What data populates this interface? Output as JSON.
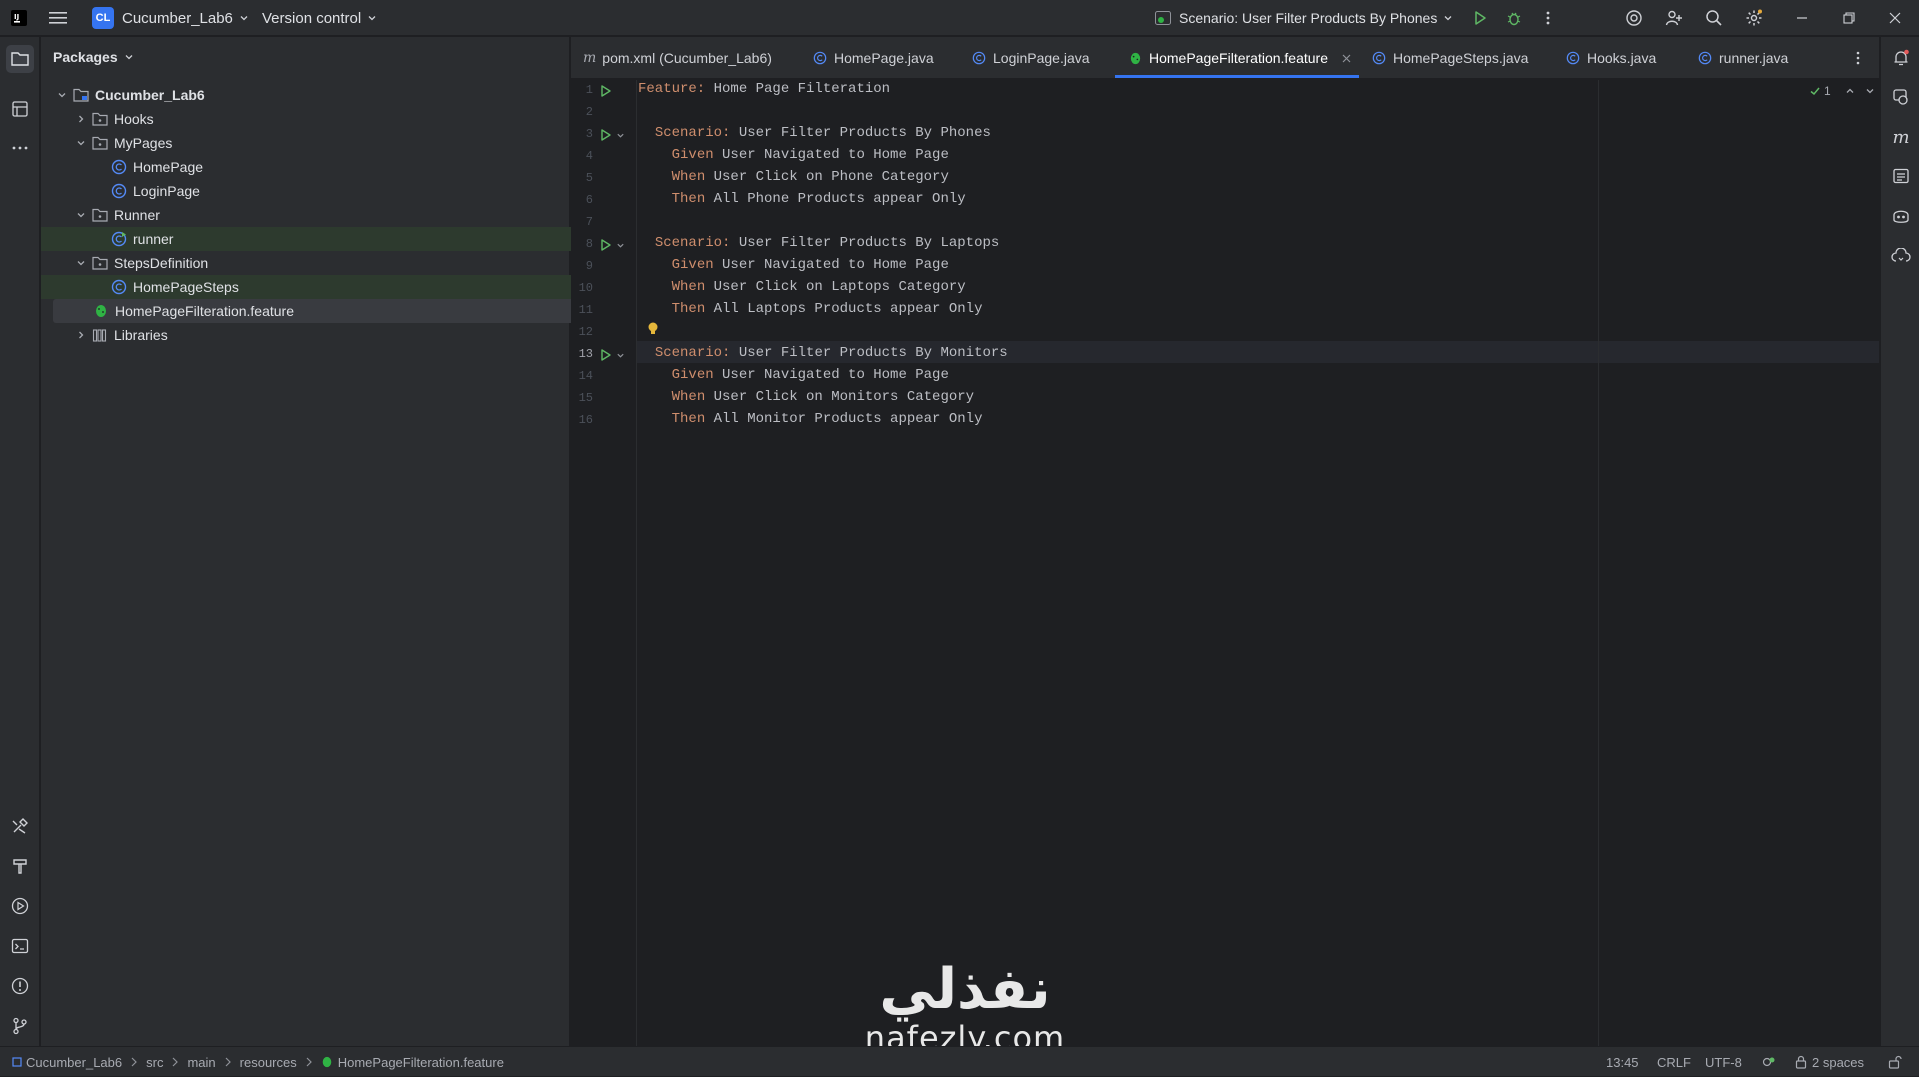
{
  "titlebar": {
    "project_badge": "CL",
    "project_name": "Cucumber_Lab6",
    "vcs": "Version control",
    "run_config": "Scenario: User Filter Products By Phones"
  },
  "project_panel": {
    "title": "Packages",
    "tree": [
      {
        "label": "Cucumber_Lab6",
        "level": 0,
        "expanded": true,
        "icon": "module-folder-icon"
      },
      {
        "label": "Hooks",
        "level": 1,
        "expanded": false,
        "icon": "package-icon"
      },
      {
        "label": "MyPages",
        "level": 1,
        "expanded": true,
        "icon": "package-icon"
      },
      {
        "label": "HomePage",
        "level": 2,
        "icon": "class-icon"
      },
      {
        "label": "LoginPage",
        "level": 2,
        "icon": "class-icon"
      },
      {
        "label": "Runner",
        "level": 1,
        "expanded": true,
        "icon": "package-icon"
      },
      {
        "label": "runner",
        "level": 2,
        "icon": "runner-class-icon"
      },
      {
        "label": "StepsDefinition",
        "level": 1,
        "expanded": true,
        "icon": "package-icon"
      },
      {
        "label": "HomePageSteps",
        "level": 2,
        "icon": "class-icon"
      },
      {
        "label": "HomePageFilteration.feature",
        "level": 1,
        "icon": "cucumber-icon",
        "selected": true
      },
      {
        "label": "Libraries",
        "level": 1,
        "expanded": false,
        "icon": "libraries-icon"
      }
    ]
  },
  "tabs": [
    {
      "label": "pom.xml (Cucumber_Lab6)",
      "icon": "maven-icon"
    },
    {
      "label": "HomePage.java",
      "icon": "class-icon"
    },
    {
      "label": "LoginPage.java",
      "icon": "class-icon"
    },
    {
      "label": "HomePageFilteration.feature",
      "icon": "cucumber-icon",
      "active": true
    },
    {
      "label": "HomePageSteps.java",
      "icon": "class-icon"
    },
    {
      "label": "Hooks.java",
      "icon": "class-icon"
    },
    {
      "label": "runner.java",
      "icon": "class-icon"
    }
  ],
  "editor": {
    "inspection_count": "1",
    "lines": [
      {
        "n": "1",
        "kw": "Feature:",
        "text": " Home Page Filteration",
        "indent": ""
      },
      {
        "n": "2",
        "kw": "",
        "text": "",
        "indent": ""
      },
      {
        "n": "3",
        "kw": "Scenario:",
        "text": " User Filter Products By Phones",
        "indent": "  "
      },
      {
        "n": "4",
        "kw": "Given",
        "text": " User Navigated to Home Page",
        "indent": "    "
      },
      {
        "n": "5",
        "kw": "When",
        "text": " User Click on Phone Category",
        "indent": "    "
      },
      {
        "n": "6",
        "kw": "Then",
        "text": " All Phone Products appear Only",
        "indent": "    "
      },
      {
        "n": "7",
        "kw": "",
        "text": "",
        "indent": ""
      },
      {
        "n": "8",
        "kw": "Scenario:",
        "text": " User Filter Products By Laptops",
        "indent": "  "
      },
      {
        "n": "9",
        "kw": "Given",
        "text": " User Navigated to Home Page",
        "indent": "    "
      },
      {
        "n": "10",
        "kw": "When",
        "text": " User Click on Laptops Category",
        "indent": "    "
      },
      {
        "n": "11",
        "kw": "Then",
        "text": " All Laptops Products appear Only",
        "indent": "    "
      },
      {
        "n": "12",
        "kw": "",
        "text": "",
        "indent": ""
      },
      {
        "n": "13",
        "kw": "Scenario:",
        "text": " User Filter Products By Monitors",
        "indent": "  "
      },
      {
        "n": "14",
        "kw": "Given",
        "text": " User Navigated to Home Page",
        "indent": "    "
      },
      {
        "n": "15",
        "kw": "When",
        "text": " User Click on Monitors Category",
        "indent": "    "
      },
      {
        "n": "16",
        "kw": "Then",
        "text": " All Monitor Products appear Only",
        "indent": "    "
      }
    ]
  },
  "statusbar": {
    "breadcrumbs": [
      "Cucumber_Lab6",
      "src",
      "main",
      "resources",
      "HomePageFilteration.feature"
    ],
    "position": "13:45",
    "line_sep": "CRLF",
    "encoding": "UTF-8",
    "indent": "2 spaces"
  },
  "watermark": {
    "arabic": "نفذلي",
    "site": "nafezly.com"
  },
  "colors": {
    "accent": "#3574f0",
    "keyword": "#cf8e6d",
    "cucumber": "#2fb344",
    "run_green": "#5fb865"
  }
}
